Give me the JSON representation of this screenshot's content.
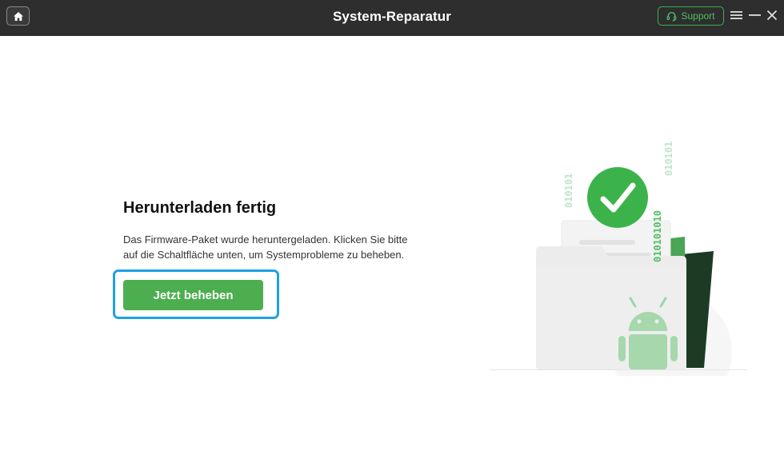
{
  "titlebar": {
    "title": "System-Reparatur",
    "support_label": "Support",
    "icons": [
      "home-icon",
      "headset-icon",
      "menu-icon",
      "minimize-icon",
      "close-icon"
    ]
  },
  "main": {
    "heading": "Herunterladen fertig",
    "description_line1": "Das Firmware-Paket wurde heruntergeladen. Klicken Sie bitte",
    "description_line2": "auf die Schaltfläche unten, um Systemprobleme zu beheben.",
    "fix_button_label": "Jetzt beheben"
  },
  "illustration": {
    "binary_left": "010101",
    "binary_right": "010101",
    "binary_middle": "010101010"
  },
  "colors": {
    "titlebar_bg": "#2e2e2e",
    "accent_green": "#4cae4f",
    "support_green": "#3bb04e",
    "focus_blue": "#1ea0e6"
  }
}
